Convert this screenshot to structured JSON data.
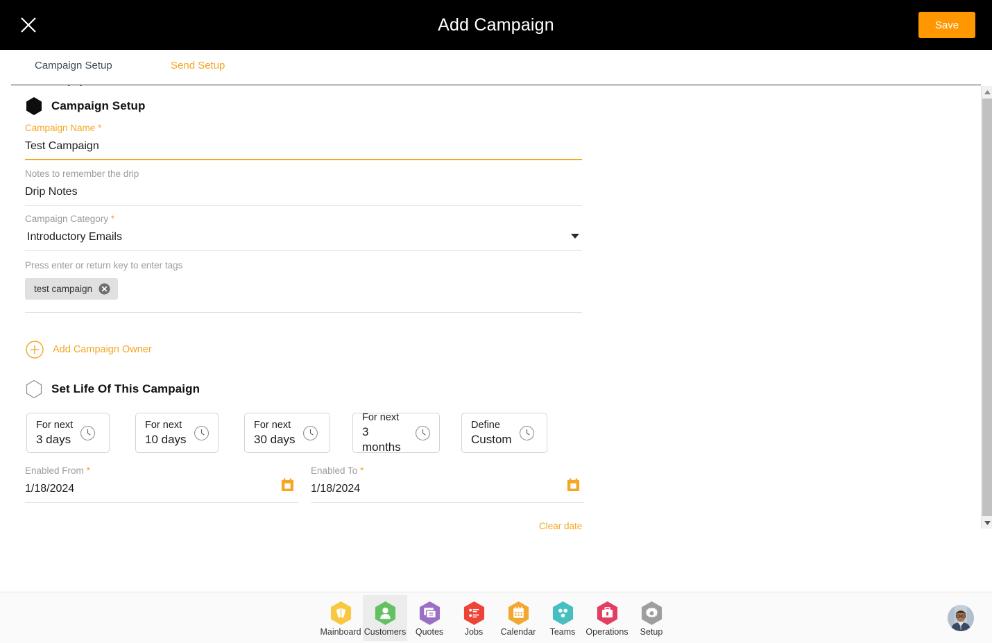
{
  "header": {
    "title": "Add Campaign",
    "close_icon": "close-icon",
    "save_label": "Save"
  },
  "tabs": [
    {
      "label": "Campaign Setup",
      "active": true
    },
    {
      "label": "Send Setup",
      "active": false
    }
  ],
  "sections": {
    "campaign_setup": {
      "title": "Campaign Setup",
      "icon": "hexagon-filled-icon"
    },
    "set_life": {
      "title": "Set Life Of This Campaign",
      "icon": "hexagon-outline-icon"
    }
  },
  "fields": {
    "campaign_name": {
      "label": "Campaign Name",
      "required_mark": "*",
      "value": "Test Campaign",
      "placeholder": "Campaign Name"
    },
    "notes": {
      "label": "Notes to remember the drip",
      "value": "Drip Notes",
      "placeholder": "Notes to remember the drip"
    },
    "category": {
      "label": "Campaign Category",
      "required_mark": "*",
      "value": "Introductory Emails",
      "options": [
        "Introductory Emails"
      ],
      "caret_icon": "chevron-down-icon"
    },
    "tags": {
      "label": "Press enter or return key to enter tags",
      "placeholder": "Press enter or return key to enter tags",
      "chips": [
        {
          "text": "test campaign",
          "remove_icon": "close-circle-icon"
        }
      ]
    },
    "enabled_from": {
      "label": "Enabled From",
      "required_mark": "*",
      "value": "1/18/2024",
      "calendar_icon": "calendar-icon"
    },
    "enabled_to": {
      "label": "Enabled To",
      "required_mark": "*",
      "value": "1/18/2024",
      "calendar_icon": "calendar-icon"
    }
  },
  "add_owner": {
    "label": "Add Campaign Owner",
    "icon": "plus-circle-icon"
  },
  "duration_options": [
    {
      "top": "For next",
      "bottom": "3 days",
      "icon": "clock-icon"
    },
    {
      "top": "For next",
      "bottom": "10 days",
      "icon": "clock-icon"
    },
    {
      "top": "For next",
      "bottom": "30 days",
      "icon": "clock-icon"
    },
    {
      "top": "For next",
      "bottom": "3 months",
      "icon": "clock-icon"
    },
    {
      "top": "Define",
      "bottom": "Custom",
      "icon": "clock-icon"
    }
  ],
  "clear_date_label": "Clear date",
  "bottom_nav": {
    "items": [
      {
        "label": "Mainboard",
        "icon": "mainboard-icon",
        "color": "#F9C841",
        "active": false
      },
      {
        "label": "Customers",
        "icon": "customers-icon",
        "color": "#63C164",
        "active": true
      },
      {
        "label": "Quotes",
        "icon": "quotes-icon",
        "color": "#9B6FC4",
        "active": false
      },
      {
        "label": "Jobs",
        "icon": "jobs-icon",
        "color": "#EE4337",
        "active": false
      },
      {
        "label": "Calendar",
        "icon": "calendar-icon",
        "color": "#F2A830",
        "active": false
      },
      {
        "label": "Teams",
        "icon": "teams-icon",
        "color": "#45BFC0",
        "active": false
      },
      {
        "label": "Operations",
        "icon": "operations-icon",
        "color": "#E33E62",
        "active": false
      },
      {
        "label": "Setup",
        "icon": "setup-gear-icon",
        "color": "#9E9E9E",
        "active": false
      }
    ],
    "avatar": "user-avatar"
  },
  "scrollbar": {
    "up_icon": "scroll-up-arrow-icon",
    "down_icon": "scroll-down-arrow-icon"
  },
  "colors": {
    "accent": "#F5A623",
    "save_button": "#FF9800",
    "topbar": "#000000"
  }
}
